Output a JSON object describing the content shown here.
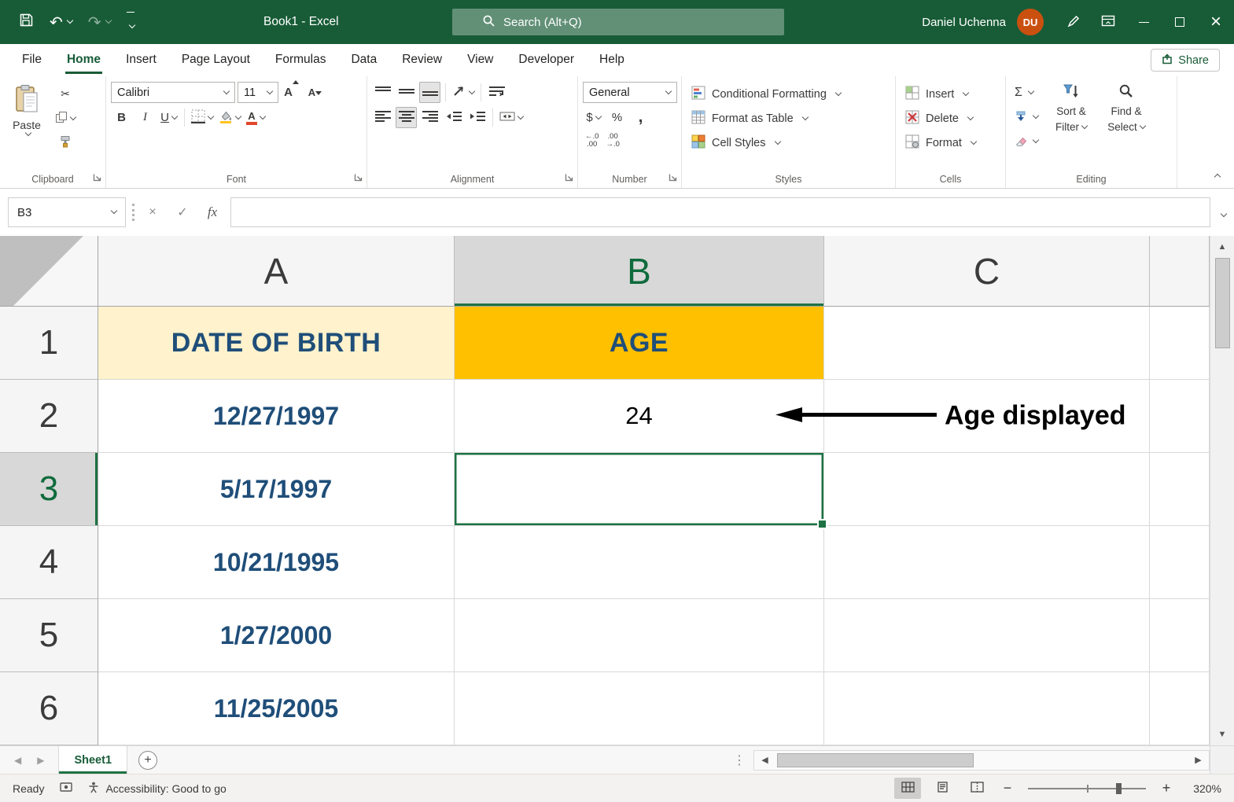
{
  "titlebar": {
    "title": "Book1 - Excel",
    "search_placeholder": "Search (Alt+Q)",
    "user_name": "Daniel Uchenna",
    "user_initials": "DU"
  },
  "menu": {
    "tabs": [
      "File",
      "Home",
      "Insert",
      "Page Layout",
      "Formulas",
      "Data",
      "Review",
      "View",
      "Developer",
      "Help"
    ],
    "active_tab": "Home",
    "share_label": "Share"
  },
  "ribbon": {
    "groups": {
      "clipboard": {
        "label": "Clipboard",
        "paste": "Paste"
      },
      "font": {
        "label": "Font",
        "family": "Calibri",
        "size": "11",
        "bold": "B",
        "italic": "I",
        "underline": "U",
        "letter": "A"
      },
      "alignment": {
        "label": "Alignment"
      },
      "number": {
        "label": "Number",
        "format": "General",
        "currency": "$",
        "percent": "%",
        "comma": ",",
        "inc_decimal": [
          "←.0",
          ".00"
        ],
        "dec_decimal": [
          ".00",
          "→.0"
        ]
      },
      "styles": {
        "label": "Styles",
        "conditional": "Conditional Formatting",
        "format_table": "Format as Table",
        "cell_styles": "Cell Styles"
      },
      "cells": {
        "label": "Cells",
        "insert": "Insert",
        "delete": "Delete",
        "format": "Format"
      },
      "editing": {
        "label": "Editing",
        "autosum": "Σ",
        "sort_line1": "Sort &",
        "sort_line2": "Filter",
        "find_line1": "Find &",
        "find_line2": "Select"
      }
    }
  },
  "formula_bar": {
    "name_box": "B3",
    "fx": "fx",
    "formula": ""
  },
  "grid": {
    "col_headers": [
      "A",
      "B",
      "C"
    ],
    "row_headers": [
      "1",
      "2",
      "3",
      "4",
      "5",
      "6"
    ],
    "selected_cell": "B3",
    "cells": {
      "A1": "DATE OF BIRTH",
      "B1": "AGE",
      "A2": "12/27/1997",
      "B2": "24",
      "A3": "5/17/1997",
      "A4": "10/21/1995",
      "A5": "1/27/2000",
      "A6": "11/25/2005"
    },
    "annotation": "Age displayed"
  },
  "sheet_bar": {
    "tab": "Sheet1"
  },
  "status_bar": {
    "ready": "Ready",
    "accessibility": "Accessibility: Good to go",
    "zoom": "320%"
  },
  "icons": {
    "undo": "↶",
    "redo": "↷",
    "cut": "✂",
    "close": "×",
    "cancel": "×",
    "check": "✓",
    "up": "▲",
    "down": "▼",
    "left": "◀",
    "right": "▶",
    "plus": "+",
    "minus": "−",
    "grip": "⋮"
  },
  "colors": {
    "title_green": "#185C37",
    "accent_green": "#1E7243",
    "header_gold": "#FFC000",
    "header_yellow": "#FFF2CC",
    "text_blue": "#1F4E79",
    "avatar_orange": "#CA5010"
  }
}
